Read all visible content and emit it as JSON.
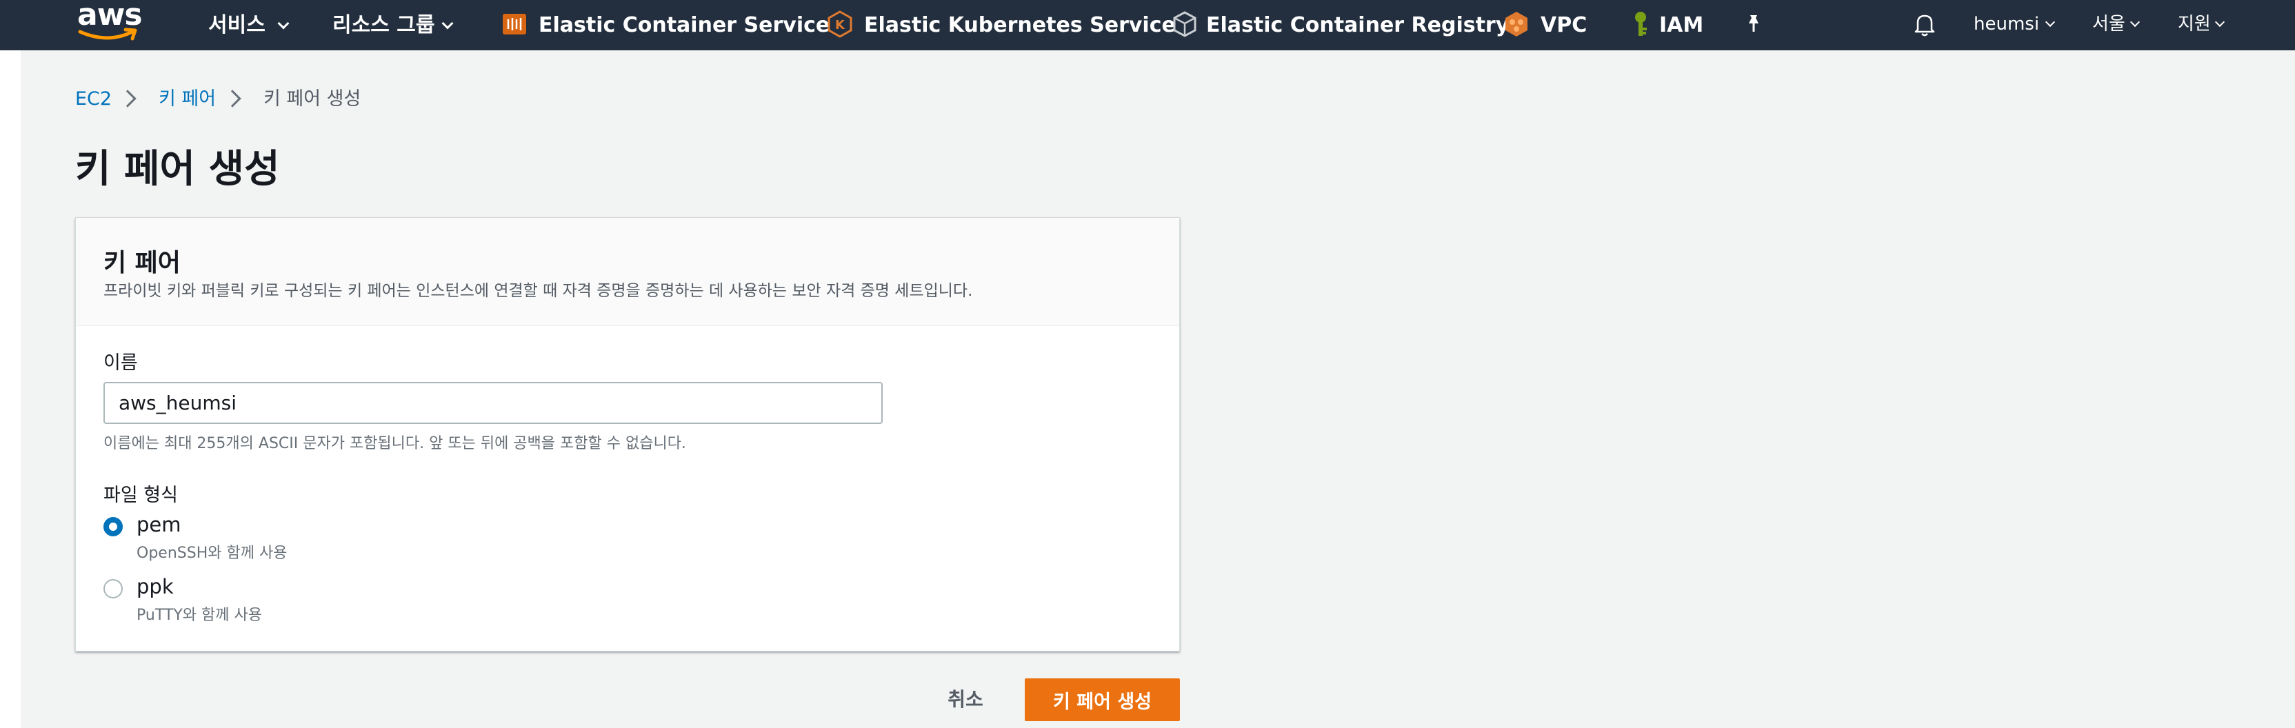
{
  "nav": {
    "logo": "aws",
    "services_label": "서비스",
    "resource_groups_label": "리소스 그룹",
    "pinned": [
      {
        "label": "Elastic Container Service",
        "icon": "ecs-icon"
      },
      {
        "label": "Elastic Kubernetes Service",
        "icon": "eks-icon"
      },
      {
        "label": "Elastic Container Registry",
        "icon": "ecr-icon"
      },
      {
        "label": "VPC",
        "icon": "vpc-icon"
      },
      {
        "label": "IAM",
        "icon": "iam-icon"
      }
    ],
    "user": "heumsi",
    "region": "서울",
    "support": "지원"
  },
  "breadcrumb": [
    "EC2",
    "키 페어",
    "키 페어 생성"
  ],
  "page_title": "키 페어 생성",
  "panel": {
    "title": "키 페어",
    "description": "프라이빗 키와 퍼블릭 키로 구성되는 키 페어는 인스턴스에 연결할 때 자격 증명을 증명하는 데 사용하는 보안 자격 증명 세트입니다.",
    "name_label": "이름",
    "name_value": "aws_heumsi",
    "name_hint": "이름에는 최대 255개의 ASCII 문자가 포함됩니다. 앞 또는 뒤에 공백을 포함할 수 없습니다.",
    "format_label": "파일 형식",
    "formats": [
      {
        "label": "pem",
        "desc": "OpenSSH와 함께 사용",
        "selected": true
      },
      {
        "label": "ppk",
        "desc": "PuTTY와 함께 사용",
        "selected": false
      }
    ]
  },
  "actions": {
    "cancel": "취소",
    "create": "키 페어 생성"
  },
  "colors": {
    "nav_bg": "#232f3e",
    "page_bg": "#f2f3f3",
    "link": "#0073bb",
    "primary": "#ec7211"
  }
}
